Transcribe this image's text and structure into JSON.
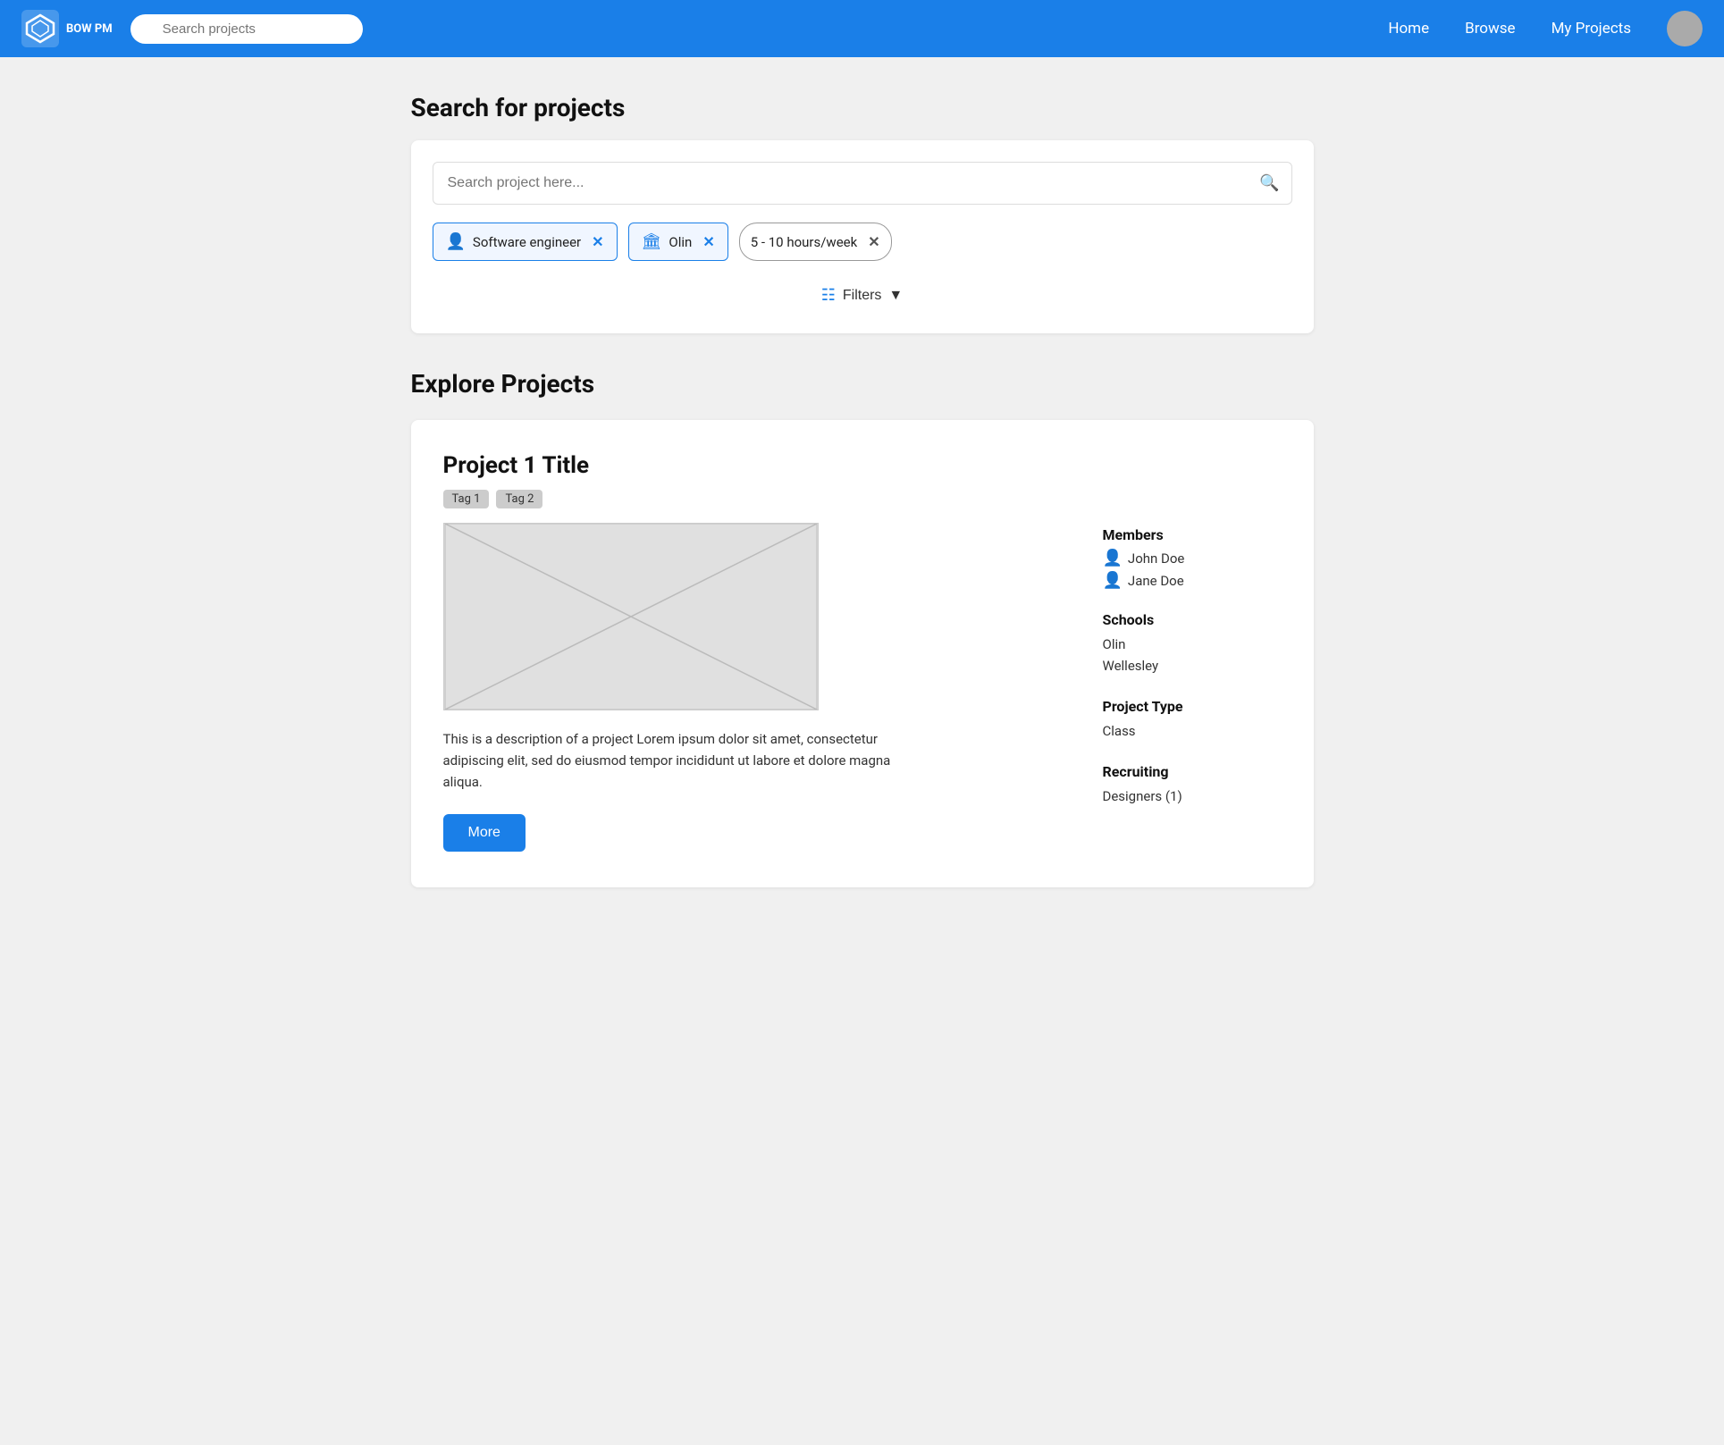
{
  "navbar": {
    "logo_text": "BOW PM",
    "search_placeholder": "Search projects",
    "links": [
      "Home",
      "Browse",
      "My Projects"
    ]
  },
  "search_section": {
    "title": "Search for projects",
    "search_input_placeholder": "Search project here...",
    "filters": [
      {
        "id": "role",
        "icon": "person",
        "label": "Software engineer"
      },
      {
        "id": "school",
        "icon": "building",
        "label": "Olin"
      }
    ],
    "hours_filter": "5 - 10 hours/week",
    "filters_button": "Filters"
  },
  "explore_section": {
    "title": "Explore Projects",
    "projects": [
      {
        "title": "Project 1 Title",
        "tags": [
          "Tag 1",
          "Tag 2"
        ],
        "description": "This is a description of a project Lorem ipsum dolor sit amet, consectetur adipiscing elit, sed do eiusmod tempor incididunt ut labore et dolore magna aliqua.",
        "more_button": "More",
        "members_heading": "Members",
        "members": [
          "John Doe",
          "Jane Doe"
        ],
        "schools_heading": "Schools",
        "schools": [
          "Olin",
          "Wellesley"
        ],
        "project_type_heading": "Project Type",
        "project_type": "Class",
        "recruiting_heading": "Recruiting",
        "recruiting": "Designers (1)"
      }
    ]
  }
}
